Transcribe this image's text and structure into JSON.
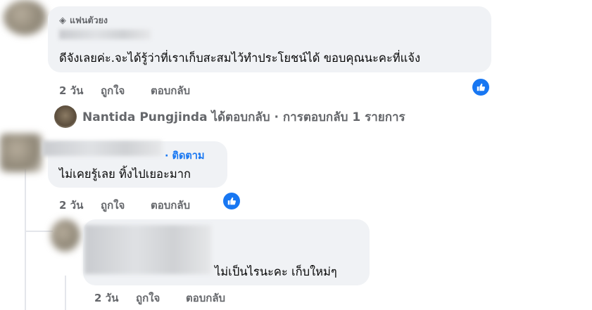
{
  "comment1": {
    "badge": "แฟนตัวยง",
    "text": "ดีจังเลยค่ะ.จะได้รู้ว่าที่เราเก็บสะสมไว้ทำประโยชน์ได้ ขอบคุณนะคะที่แจ้ง",
    "time": "2 วัน",
    "like": "ถูกใจ",
    "reply": "ตอบกลับ"
  },
  "reply_summary": {
    "text": "Nantida Pungjinda ได้ตอบกลับ · การตอบกลับ 1 รายการ"
  },
  "comment2": {
    "follow": "· ติดตาม",
    "text": "ไม่เคยรู้เลย ทิ้งไปเยอะมาก",
    "time": "2 วัน",
    "like": "ถูกใจ",
    "reply": "ตอบกลับ"
  },
  "comment3": {
    "text": "ไม่เป็นไรนะคะ เก็บใหม่ๆ",
    "time": "2 วัน",
    "like": "ถูกใจ",
    "reply": "ตอบกลับ"
  },
  "colors": {
    "accent": "#1877f2",
    "bubble": "#f0f2f5",
    "meta": "#65676b"
  }
}
